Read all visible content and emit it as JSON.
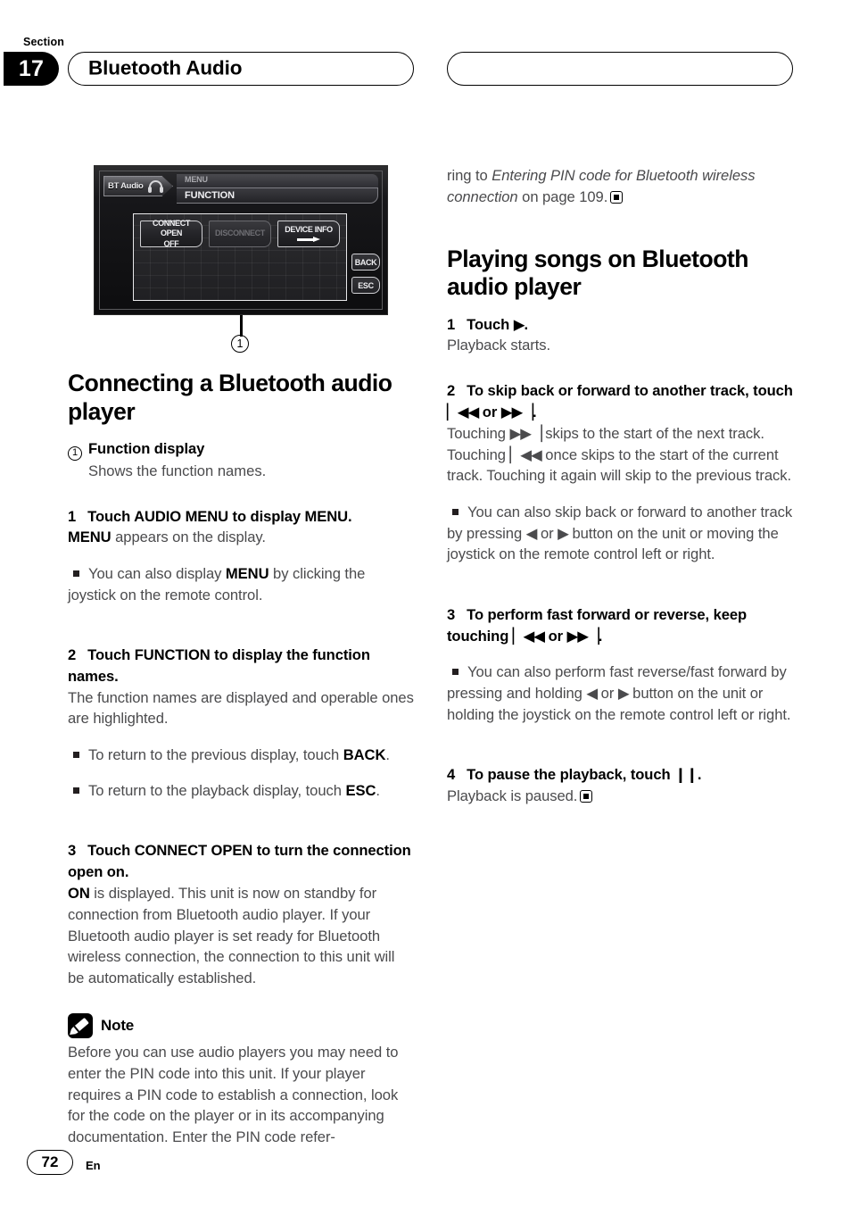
{
  "header": {
    "section_label": "Section",
    "section_number": "17",
    "title": "Bluetooth Audio",
    "right_pill_title": ""
  },
  "figure": {
    "device": {
      "source_label": "BT Audio",
      "menu_label": "MENU",
      "function_label": "FUNCTION",
      "buttons": [
        {
          "line1": "CONNECT OPEN",
          "line2": "OFF",
          "state": "active"
        },
        {
          "line1": "DISCONNECT",
          "line2": "",
          "state": "dimmed"
        },
        {
          "line1": "DEVICE INFO",
          "line2": "",
          "state": "active",
          "icon": "right-arrow-icon"
        }
      ],
      "side_buttons": [
        {
          "label": "BACK"
        },
        {
          "label": "ESC"
        }
      ]
    },
    "callout_number": "1"
  },
  "left_column": {
    "heading": "Connecting a Bluetooth audio player",
    "callout": {
      "number": "1",
      "term": "Function display",
      "description": "Shows the function names."
    },
    "steps": [
      {
        "num": "1",
        "title_parts": [
          {
            "t": "Touch ",
            "b": false
          },
          {
            "t": "AUDIO MENU",
            "b": true
          },
          {
            "t": " to display ",
            "b": false
          },
          {
            "t": "MENU",
            "b": true
          },
          {
            "t": ".",
            "b": false
          }
        ],
        "body_parts": [
          {
            "t": "MENU",
            "b": true
          },
          {
            "t": " appears on the display.",
            "b": false
          }
        ],
        "bullets": [
          [
            {
              "t": "You can also display ",
              "b": false
            },
            {
              "t": "MENU",
              "b": true
            },
            {
              "t": " by clicking the joystick on the remote control.",
              "b": false
            }
          ]
        ]
      },
      {
        "num": "2",
        "title_parts": [
          {
            "t": "Touch ",
            "b": false
          },
          {
            "t": "FUNCTION",
            "b": true
          },
          {
            "t": " to display the function names.",
            "b": false
          }
        ],
        "body_parts": [
          {
            "t": "The function names are displayed and operable ones are highlighted.",
            "b": false
          }
        ],
        "bullets": [
          [
            {
              "t": "To return to the previous display, touch ",
              "b": false
            },
            {
              "t": "BACK",
              "b": true
            },
            {
              "t": ".",
              "b": false
            }
          ],
          [
            {
              "t": "To return to the playback display, touch ",
              "b": false
            },
            {
              "t": "ESC",
              "b": true
            },
            {
              "t": ".",
              "b": false
            }
          ]
        ]
      },
      {
        "num": "3",
        "title_parts": [
          {
            "t": "Touch ",
            "b": false
          },
          {
            "t": "CONNECT OPEN",
            "b": true
          },
          {
            "t": " to turn the connection open on.",
            "b": false
          }
        ],
        "body_parts": [
          {
            "t": "ON",
            "b": true
          },
          {
            "t": " is displayed. This unit is now on standby for connection from Bluetooth audio player. If your Bluetooth audio player is set ready for Bluetooth wireless connection, the connection to this unit will be automatically established.",
            "b": false
          }
        ],
        "bullets": []
      }
    ],
    "note": {
      "icon": "note-pencil-icon",
      "title": "Note",
      "text": "Before you can use audio players you may need to enter the PIN code into this unit. If your player requires a PIN code to establish a connection, look for the code on the player or in its accompanying documentation. Enter the PIN code refer-"
    }
  },
  "right_column": {
    "continuation": {
      "lead": "ring to ",
      "italic": "Entering PIN code for Bluetooth wireless connection",
      "tail": " on page 109.",
      "end_marker": "end-of-section-icon"
    },
    "heading": "Playing songs on Bluetooth audio player",
    "steps": [
      {
        "num": "1",
        "title_parts": [
          {
            "t": "Touch ",
            "b": false
          },
          {
            "t": "▶",
            "b": false,
            "glyph": true
          },
          {
            "t": ".",
            "b": false
          }
        ],
        "body_parts": [
          {
            "t": "Playback starts.",
            "b": false
          }
        ],
        "bullets": []
      },
      {
        "num": "2",
        "title_parts": [
          {
            "t": "To skip back or forward to another track, touch ",
            "b": false
          },
          {
            "t": "▏◀◀",
            "b": false,
            "glyph": true
          },
          {
            "t": " or ",
            "b": false
          },
          {
            "t": "▶▶▕",
            "b": false,
            "glyph": true
          },
          {
            "t": ".",
            "b": false
          }
        ],
        "body_parts": [
          {
            "t": "Touching ",
            "b": false
          },
          {
            "t": "▶▶▕",
            "b": false,
            "glyph": true
          },
          {
            "t": " skips to the start of the next track. Touching ",
            "b": false
          },
          {
            "t": "▏◀◀",
            "b": false,
            "glyph": true
          },
          {
            "t": " once skips to the start of the current track. Touching it again will skip to the previous track.",
            "b": false
          }
        ],
        "bullets": [
          [
            {
              "t": "You can also skip back or forward to another track by pressing ",
              "b": false
            },
            {
              "t": "◀",
              "b": false,
              "glyph": true
            },
            {
              "t": " or ",
              "b": false
            },
            {
              "t": "▶",
              "b": false,
              "glyph": true
            },
            {
              "t": " button on the unit or moving the joystick on the remote control left or right.",
              "b": false
            }
          ]
        ]
      },
      {
        "num": "3",
        "title_parts": [
          {
            "t": "To perform fast forward or reverse, keep touching ",
            "b": false
          },
          {
            "t": "▏◀◀",
            "b": false,
            "glyph": true
          },
          {
            "t": " or ",
            "b": false
          },
          {
            "t": "▶▶▕",
            "b": false,
            "glyph": true
          },
          {
            "t": ".",
            "b": false
          }
        ],
        "body_parts": [],
        "bullets": [
          [
            {
              "t": "You can also perform fast reverse/fast forward by pressing and holding ",
              "b": false
            },
            {
              "t": "◀",
              "b": false,
              "glyph": true
            },
            {
              "t": " or ",
              "b": false
            },
            {
              "t": "▶",
              "b": false,
              "glyph": true
            },
            {
              "t": " button on the unit or holding the joystick on the remote control left or right.",
              "b": false
            }
          ]
        ]
      },
      {
        "num": "4",
        "title_parts": [
          {
            "t": "To pause the playback, touch ",
            "b": false
          },
          {
            "t": "❙❙",
            "b": false,
            "glyph": true
          },
          {
            "t": ".",
            "b": false
          }
        ],
        "body_parts": [
          {
            "t": "Playback is paused.",
            "b": false
          }
        ],
        "bullets": [],
        "end_marker": true
      }
    ]
  },
  "footer": {
    "page_number": "72",
    "language": "En"
  }
}
